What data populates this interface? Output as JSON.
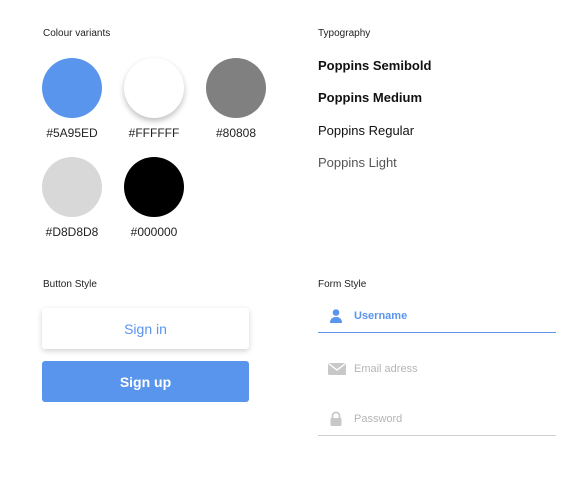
{
  "colour_variants": {
    "title": "Colour variants",
    "swatches": [
      {
        "color": "#5A95ED",
        "label": "#5A95ED"
      },
      {
        "color": "#FFFFFF",
        "label": "#FFFFFF"
      },
      {
        "color": "#808080",
        "label": "#80808"
      },
      {
        "color": "#D8D8D8",
        "label": "#D8D8D8"
      },
      {
        "color": "#000000",
        "label": "#000000"
      }
    ]
  },
  "typography": {
    "title": "Typography",
    "samples": [
      "Poppins Semibold",
      "Poppins Medium",
      "Poppins Regular",
      "Poppins Light"
    ]
  },
  "button_style": {
    "title": "Button Style",
    "sign_in": "Sign in",
    "sign_up": "Sign up"
  },
  "form_style": {
    "title": "Form  Style",
    "username": "Username",
    "email": "Email adress",
    "password": "Password"
  },
  "colors": {
    "accent": "#5A95ED",
    "icon_inactive": "#c8c8c8",
    "line_inactive": "#d0d0d0"
  }
}
